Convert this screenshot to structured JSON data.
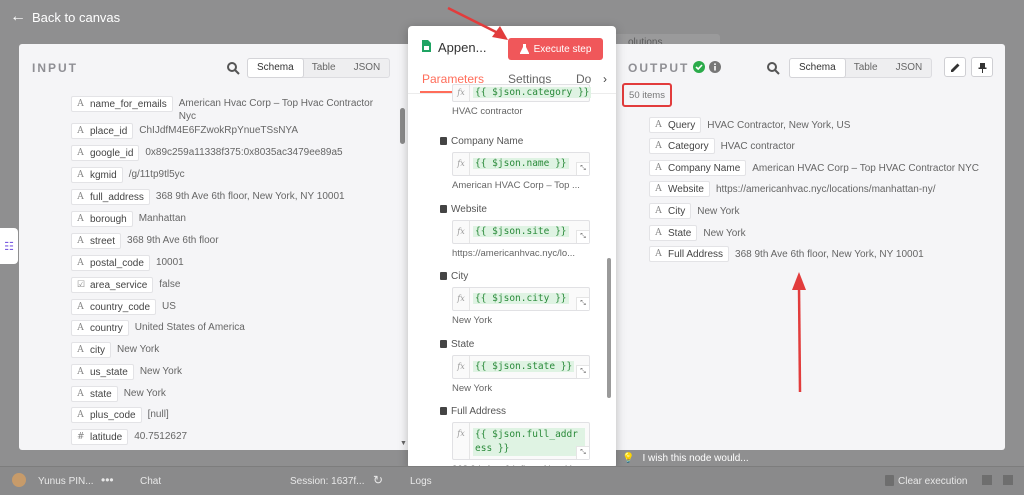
{
  "topbar": {
    "back_label": "Back to canvas"
  },
  "input": {
    "title": "INPUT",
    "tabs": [
      "Schema",
      "Table",
      "JSON"
    ],
    "selected_tab": "Schema",
    "fields": [
      {
        "type": "A",
        "key": "name_for_emails",
        "value": "American Hvac Corp – Top Hvac Contractor Nyc"
      },
      {
        "type": "A",
        "key": "place_id",
        "value": "ChIJdfM4E6FZwokRpYnueTSsNYA"
      },
      {
        "type": "A",
        "key": "google_id",
        "value": "0x89c259a11338f375:0x8035ac3479ee89a5"
      },
      {
        "type": "A",
        "key": "kgmid",
        "value": "/g/11tp9tl5yc"
      },
      {
        "type": "A",
        "key": "full_address",
        "value": "368 9th Ave 6th floor, New York, NY 10001"
      },
      {
        "type": "A",
        "key": "borough",
        "value": "Manhattan"
      },
      {
        "type": "A",
        "key": "street",
        "value": "368 9th Ave 6th floor"
      },
      {
        "type": "A",
        "key": "postal_code",
        "value": "10001"
      },
      {
        "type": "☑",
        "key": "area_service",
        "value": "false"
      },
      {
        "type": "A",
        "key": "country_code",
        "value": "US"
      },
      {
        "type": "A",
        "key": "country",
        "value": "United States of America"
      },
      {
        "type": "A",
        "key": "city",
        "value": "New York"
      },
      {
        "type": "A",
        "key": "us_state",
        "value": "New York"
      },
      {
        "type": "A",
        "key": "state",
        "value": "New York"
      },
      {
        "type": "A",
        "key": "plus_code",
        "value": "[null]"
      },
      {
        "type": "#",
        "key": "latitude",
        "value": "40.7512627"
      }
    ]
  },
  "node": {
    "title": "Appen...",
    "execute_label": "Execute step",
    "tabs": [
      "Parameters",
      "Settings",
      "Do"
    ],
    "active_tab": "Parameters",
    "top_partial": {
      "expression": "{{ $json.category }}",
      "result": "HVAC contractor"
    },
    "params": [
      {
        "label": "Company Name",
        "expression": "{{ $json.name }}",
        "result": "American HVAC Corp – Top ..."
      },
      {
        "label": "Website",
        "expression": "{{ $json.site }}",
        "result": "https://americanhvac.nyc/lo..."
      },
      {
        "label": "City",
        "expression": "{{ $json.city }}",
        "result": "New York"
      },
      {
        "label": "State",
        "expression": "{{ $json.state }}",
        "result": "New York"
      },
      {
        "label": "Full Address",
        "expression": "{{ $json.full_address }}",
        "result": "368 9th Ave 6th floor, New Y"
      }
    ]
  },
  "output": {
    "title": "OUTPUT",
    "items_label": "50 items",
    "tabs": [
      "Schema",
      "Table",
      "JSON"
    ],
    "selected_tab": "Schema",
    "fields": [
      {
        "type": "A",
        "key": "Query",
        "value": "HVAC Contractor, New York, US"
      },
      {
        "type": "A",
        "key": "Category",
        "value": "HVAC contractor"
      },
      {
        "type": "A",
        "key": "Company Name",
        "value": "American HVAC Corp – Top HVAC Contractor NYC"
      },
      {
        "type": "A",
        "key": "Website",
        "value": "https://americanhvac.nyc/locations/manhattan-ny/"
      },
      {
        "type": "A",
        "key": "City",
        "value": "New York"
      },
      {
        "type": "A",
        "key": "State",
        "value": "New York"
      },
      {
        "type": "A",
        "key": "Full Address",
        "value": "368 9th Ave 6th floor, New York, NY 10001"
      }
    ],
    "hint": "I wish this node would..."
  },
  "bottombar": {
    "user": "Yunus PIN...",
    "chat": "Chat",
    "session": "Session: 1637f...",
    "logs": "Logs",
    "clear": "Clear execution"
  },
  "background": {
    "tab_fragment": "olutions"
  },
  "colors": {
    "accent": "#ff6d5a",
    "execute": "#f0575a",
    "annotation": "#e23c3c",
    "success": "#2bab4a"
  }
}
